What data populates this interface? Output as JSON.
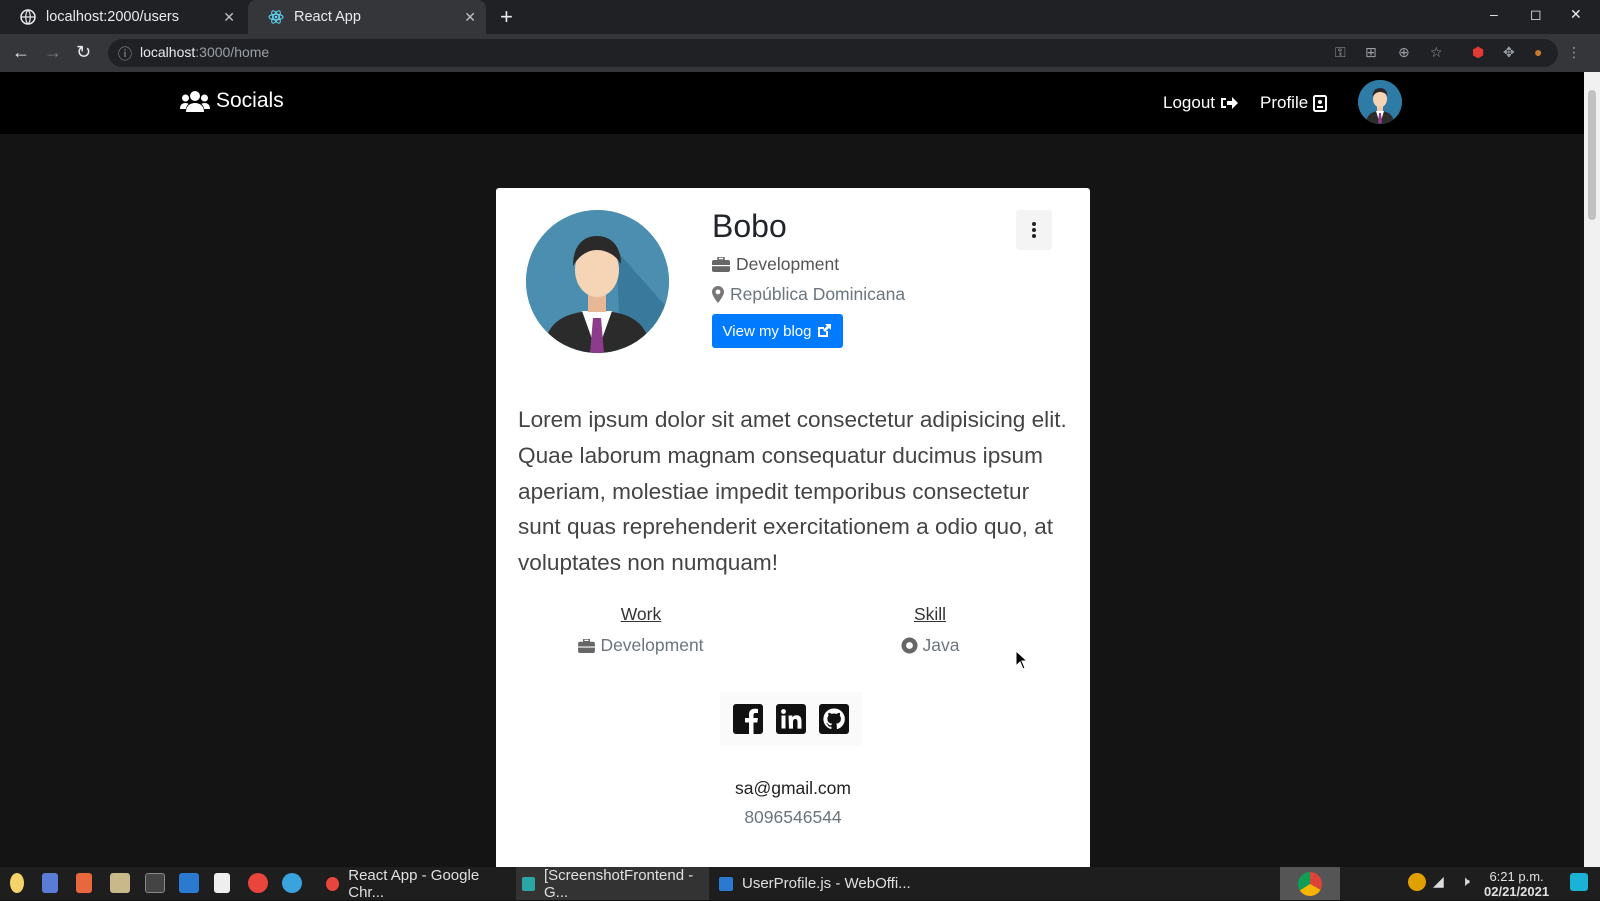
{
  "browser": {
    "tabs": [
      {
        "title": "localhost:2000/users"
      },
      {
        "title": "React App"
      }
    ],
    "url_host": "localhost",
    "url_path": ":3000/home"
  },
  "navbar": {
    "brand": "Socials",
    "logout": "Logout",
    "profile": "Profile"
  },
  "profile": {
    "name": "Bobo",
    "occupation": "Development",
    "location": "República Dominicana",
    "blog_button": "View my blog",
    "bio": "Lorem ipsum dolor sit amet consectetur adipisicing elit. Quae laborum magnam consequatur ducimus ipsum aperiam, molestiae impedit temporibus consectetur sunt quas reprehenderit exercitationem a odio quo, at voluptates non numquam!",
    "work_heading": "Work",
    "work_value": "Development",
    "skill_heading": "Skill",
    "skill_value": "Java",
    "email": "sa@gmail.com",
    "phone": "8096546544"
  },
  "taskbar": {
    "tasks": [
      {
        "label": "React App - Google Chr..."
      },
      {
        "label": "[ScreenshotFrontend - G..."
      },
      {
        "label": "UserProfile.js - WebOffi..."
      }
    ],
    "time": "6:21 p.m.",
    "date": "02/21/2021"
  },
  "colors": {
    "accent": "#007bff",
    "navbar_bg": "#000000",
    "page_bg": "#141414"
  }
}
